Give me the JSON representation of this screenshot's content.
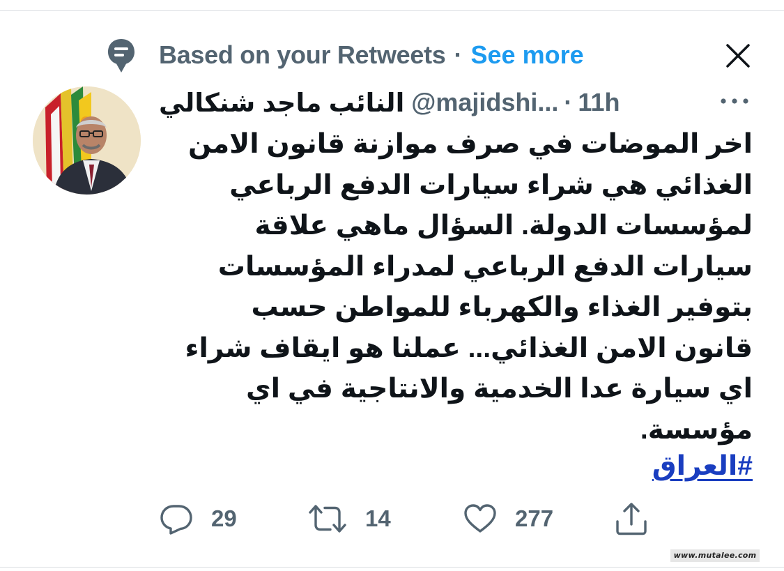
{
  "social_context": {
    "text": "Based on your Retweets",
    "separator": "·",
    "see_more": "See more",
    "icon": "speech-bubble-lines-icon"
  },
  "close": {
    "icon": "close-icon"
  },
  "tweet": {
    "display_name": "النائب ماجد شنكالي",
    "handle": "@majidshi...",
    "separator": "·",
    "time": "11h",
    "more_icon": "ellipsis-icon",
    "lines": [
      "اخر الموضات في صرف موازنة قانون الامن",
      "الغذائي هي شراء سيارات الدفع الرباعي",
      "لمؤسسات الدولة. السؤال ماهي علاقة",
      "سيارات الدفع الرباعي لمدراء المؤسسات",
      "بتوفير الغذاء والكهرباء للمواطن حسب",
      "قانون الامن الغذائي... عملنا هو ايقاف شراء",
      "اي سيارة عدا الخدمية والانتاجية في اي",
      "مؤسسة."
    ],
    "hashtag": "#العراق"
  },
  "actions": {
    "reply": {
      "icon": "reply-icon",
      "count": "29"
    },
    "retweet": {
      "icon": "retweet-icon",
      "count": "14"
    },
    "like": {
      "icon": "heart-icon",
      "count": "277"
    },
    "share": {
      "icon": "share-icon"
    }
  },
  "watermark": "www.mutalee.com",
  "colors": {
    "text": "#0f1419",
    "secondary": "#536471",
    "link": "#1d9bf0",
    "hashtag": "#1a3ec0"
  }
}
